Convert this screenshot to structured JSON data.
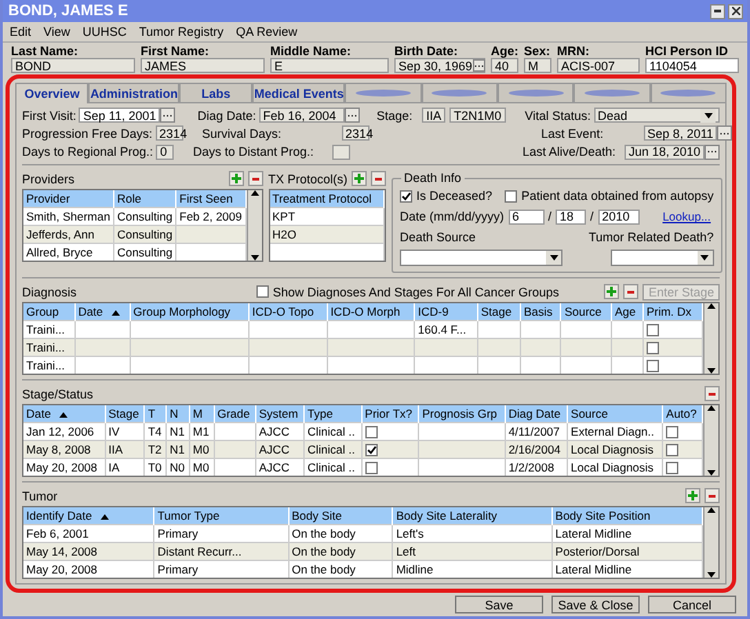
{
  "window": {
    "title": "BOND, JAMES E"
  },
  "menu": [
    "Edit",
    "View",
    "UUHSC",
    "Tumor Registry",
    "QA Review"
  ],
  "patient": [
    {
      "label": "Last Name:",
      "value": "BOND",
      "kind": "text",
      "editable": false
    },
    {
      "label": "First Name:",
      "value": "JAMES",
      "kind": "text",
      "editable": false
    },
    {
      "label": "Middle Name:",
      "value": "E",
      "kind": "text",
      "editable": false
    },
    {
      "label": "Birth Date:",
      "value": "Sep 30, 1969",
      "kind": "date",
      "editable": false
    },
    {
      "label": "Age:",
      "value": "40",
      "kind": "text",
      "editable": false
    },
    {
      "label": "Sex:",
      "value": "M",
      "kind": "text",
      "editable": false
    },
    {
      "label": "MRN:",
      "value": "ACIS-007",
      "kind": "text",
      "editable": false
    },
    {
      "label": "HCI Person ID",
      "value": "1104054",
      "kind": "text",
      "editable": true
    }
  ],
  "tabs": [
    {
      "kind": "label",
      "label": "Overview",
      "selected": true
    },
    {
      "kind": "label",
      "label": "Administration",
      "selected": false
    },
    {
      "kind": "label",
      "label": "Labs",
      "selected": false
    },
    {
      "kind": "label",
      "label": "Medical Events",
      "selected": false
    },
    {
      "kind": "blurred",
      "selected": false
    },
    {
      "kind": "blurred",
      "selected": false
    },
    {
      "kind": "blurred",
      "selected": false
    },
    {
      "kind": "blurred",
      "selected": false
    },
    {
      "kind": "blurred",
      "selected": false
    }
  ],
  "summary": {
    "first_visit": {
      "label": "First Visit:",
      "value": "Sep 11, 2001",
      "editable": true
    },
    "diag_date": {
      "label": "Diag Date:",
      "value": "Feb 16, 2004",
      "editable": false
    },
    "stage": {
      "label": "Stage:",
      "values": [
        "IIA",
        "T2N1M0"
      ]
    },
    "vital_status": {
      "label": "Vital Status:",
      "value": "Dead"
    },
    "progression_free_days": {
      "label": "Progression Free Days:",
      "value": "2314"
    },
    "survival_days": {
      "label": "Survival Days:",
      "value": "2314"
    },
    "last_event": {
      "label": "Last Event:",
      "value": "Sep 8, 2011"
    },
    "days_to_regional_prog": {
      "label": "Days to Regional Prog.:",
      "value": "0"
    },
    "days_to_distant_prog": {
      "label": "Days to Distant Prog.:"
    },
    "last_alive_death": {
      "label": "Last Alive/Death:",
      "value": "Jun 18, 2010"
    }
  },
  "providers": {
    "title": "Providers",
    "columns": [
      {
        "label": "Provider",
        "sorted": false
      },
      {
        "label": "Role",
        "sorted": false
      },
      {
        "label": "First Seen",
        "sorted": false
      }
    ],
    "rows": [
      [
        "Smith, Sherman",
        "Consulting",
        "Feb 2, 2009"
      ],
      [
        "Jefferds, Ann",
        "Consulting",
        null
      ],
      [
        "Allred, Bryce",
        "Consulting",
        null
      ]
    ]
  },
  "tx_protocols": {
    "title": "TX Protocol(s)",
    "columns": [
      {
        "label": "Treatment Protocol",
        "sorted": false
      }
    ],
    "rows": [
      [
        "KPT"
      ],
      [
        "H2O"
      ],
      [
        null
      ]
    ]
  },
  "death_info": {
    "title": "Death Info",
    "deceased": {
      "label": "Is Deceased?",
      "checked": true
    },
    "autopsy": {
      "label": "Patient data obtained from autopsy",
      "checked": false
    },
    "date": {
      "label": "Date (mm/dd/yyyy)",
      "month": "6",
      "day": "18",
      "year": "2010",
      "separators": [
        "/",
        "/"
      ]
    },
    "lookup": "Lookup...",
    "death_source": {
      "label": "Death Source"
    },
    "tumor_related": {
      "label": "Tumor Related Death?"
    }
  },
  "diagnosis": {
    "title": "Diagnosis",
    "show_all": {
      "label": "Show Diagnoses And Stages For All Cancer Groups",
      "checked": false
    },
    "enter_stage": {
      "label": "Enter Stage",
      "disabled": true
    },
    "columns": [
      {
        "label": "Group",
        "sorted": false
      },
      {
        "label": "Date",
        "sorted": true
      },
      {
        "label": "Group Morphology",
        "sorted": false
      },
      {
        "label": "ICD-O Topo",
        "sorted": false
      },
      {
        "label": "ICD-O Morph",
        "sorted": false
      },
      {
        "label": "ICD-9",
        "sorted": false
      },
      {
        "label": "Stage",
        "sorted": false
      },
      {
        "label": "Basis",
        "sorted": false
      },
      {
        "label": "Source",
        "sorted": false
      },
      {
        "label": "Age",
        "sorted": false
      },
      {
        "label": "Prim. Dx",
        "sorted": false
      }
    ],
    "rows": [
      [
        "Traini...",
        null,
        null,
        null,
        null,
        "160.4 F...",
        null,
        null,
        null,
        null,
        {
          "checked": false
        }
      ],
      [
        "Traini...",
        null,
        null,
        null,
        null,
        null,
        null,
        null,
        null,
        null,
        {
          "checked": false
        }
      ],
      [
        "Traini...",
        null,
        null,
        null,
        null,
        null,
        null,
        null,
        null,
        null,
        {
          "checked": false
        }
      ]
    ]
  },
  "stage_status": {
    "title": "Stage/Status",
    "columns": [
      {
        "label": "Date",
        "sorted": true
      },
      {
        "label": "Stage",
        "sorted": false
      },
      {
        "label": "T",
        "sorted": false
      },
      {
        "label": "N",
        "sorted": false
      },
      {
        "label": "M",
        "sorted": false
      },
      {
        "label": "Grade",
        "sorted": false
      },
      {
        "label": "System",
        "sorted": false
      },
      {
        "label": "Type",
        "sorted": false
      },
      {
        "label": "Prior Tx?",
        "sorted": false
      },
      {
        "label": "Prognosis Grp",
        "sorted": false
      },
      {
        "label": "Diag Date",
        "sorted": false
      },
      {
        "label": "Source",
        "sorted": false
      },
      {
        "label": "Auto?",
        "sorted": false
      }
    ],
    "rows": [
      [
        "Jan 12, 2006",
        "IV",
        "T4",
        "N1",
        "M1",
        null,
        "AJCC",
        "Clinical ..",
        {
          "checked": false
        },
        null,
        "4/11/2007",
        "External Diagn..",
        {
          "checked": false
        }
      ],
      [
        "May 8, 2008",
        "IIA",
        "T2",
        "N1",
        "M0",
        null,
        "AJCC",
        "Clinical ..",
        {
          "checked": true
        },
        null,
        "2/16/2004",
        "Local Diagnosis",
        {
          "checked": false
        }
      ],
      [
        "May 20, 2008",
        "IA",
        "T0",
        "N0",
        "M0",
        null,
        "AJCC",
        "Clinical ..",
        {
          "checked": false
        },
        null,
        "1/2/2008",
        "Local Diagnosis",
        {
          "checked": false
        }
      ]
    ]
  },
  "tumor": {
    "title": "Tumor",
    "columns": [
      {
        "label": "Identify Date",
        "sorted": true
      },
      {
        "label": "Tumor Type",
        "sorted": false
      },
      {
        "label": "Body Site",
        "sorted": false
      },
      {
        "label": "Body Site Laterality",
        "sorted": false
      },
      {
        "label": "Body Site Position",
        "sorted": false
      }
    ],
    "rows": [
      [
        "Feb 6, 2001",
        "Primary",
        "On the body",
        "Left's",
        "Lateral Midline"
      ],
      [
        "May 14, 2008",
        "Distant Recurr...",
        "On the body",
        "Left",
        "Posterior/Dorsal"
      ],
      [
        "May 20, 2008",
        "Primary",
        "On the body",
        "Midline",
        "Lateral Midline"
      ]
    ]
  },
  "buttons": [
    "Save",
    "Save & Close",
    "Cancel"
  ]
}
